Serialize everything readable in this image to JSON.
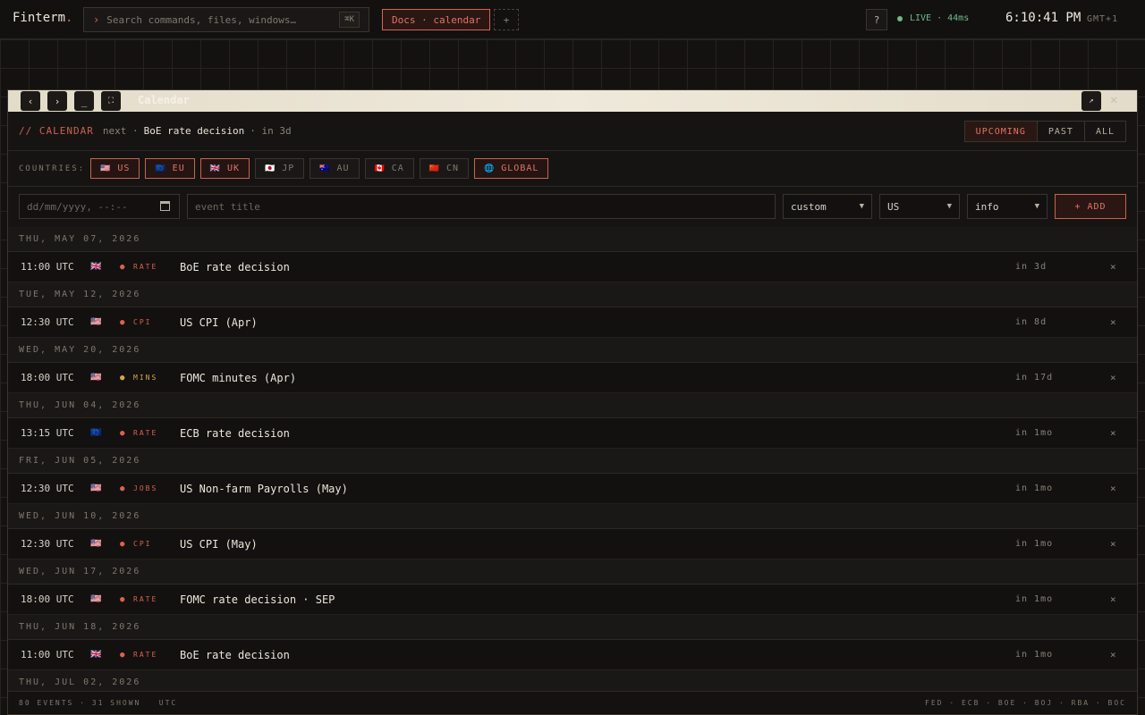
{
  "app": {
    "brand": "Finterm",
    "brand_dot": "."
  },
  "search": {
    "placeholder": "Search commands, files, windows…",
    "shortcut": "⌘K"
  },
  "tabs": {
    "active_label": "Docs · calendar",
    "add_label": "+"
  },
  "status": {
    "help": "?",
    "live": "LIVE · 44ms",
    "clock": "6:10:41 PM",
    "tz": "GMT+1"
  },
  "window": {
    "title": "Calendar",
    "back": "‹",
    "forward": "›",
    "minimize": "_",
    "maximize": "⛶",
    "popout": "↗",
    "close": "✕"
  },
  "subheader": {
    "label": "// CALENDAR",
    "next_prefix": "next ·",
    "next_event": "BoE rate decision",
    "next_rel": "· in 3d"
  },
  "filter": {
    "options": [
      "UPCOMING",
      "PAST",
      "ALL"
    ],
    "active": "UPCOMING"
  },
  "countries": {
    "label": "COUNTRIES:",
    "items": [
      {
        "flag": "🇺🇸",
        "code": "US",
        "active": true
      },
      {
        "flag": "🇪🇺",
        "code": "EU",
        "active": true
      },
      {
        "flag": "🇬🇧",
        "code": "UK",
        "active": true
      },
      {
        "flag": "🇯🇵",
        "code": "JP",
        "active": false
      },
      {
        "flag": "🇦🇺",
        "code": "AU",
        "active": false
      },
      {
        "flag": "🇨🇦",
        "code": "CA",
        "active": false
      },
      {
        "flag": "🇨🇳",
        "code": "CN",
        "active": false
      },
      {
        "flag": "🌐",
        "code": "GLOBAL",
        "active": true
      }
    ]
  },
  "form": {
    "datetime_placeholder": "dd/mm/yyyy, --:--",
    "title_placeholder": "event title",
    "type_value": "custom",
    "country_value": "US",
    "importance_value": "info",
    "add_label": "+ ADD"
  },
  "groups": [
    {
      "date": "THU, MAY 07, 2026",
      "events": [
        {
          "time": "11:00 UTC",
          "flag": "🇬🇧",
          "cat": "RATE",
          "color": "#d9624e",
          "title": "BoE rate decision",
          "rel": "in 3d"
        }
      ]
    },
    {
      "date": "TUE, MAY 12, 2026",
      "events": [
        {
          "time": "12:30 UTC",
          "flag": "🇺🇸",
          "cat": "CPI",
          "color": "#d9624e",
          "title": "US CPI (Apr)",
          "rel": "in 8d"
        }
      ]
    },
    {
      "date": "WED, MAY 20, 2026",
      "events": [
        {
          "time": "18:00 UTC",
          "flag": "🇺🇸",
          "cat": "MINS",
          "color": "#d9a24e",
          "title": "FOMC minutes (Apr)",
          "rel": "in 17d"
        }
      ]
    },
    {
      "date": "THU, JUN 04, 2026",
      "events": [
        {
          "time": "13:15 UTC",
          "flag": "🇪🇺",
          "cat": "RATE",
          "color": "#d9624e",
          "title": "ECB rate decision",
          "rel": "in 1mo"
        }
      ]
    },
    {
      "date": "FRI, JUN 05, 2026",
      "events": [
        {
          "time": "12:30 UTC",
          "flag": "🇺🇸",
          "cat": "JOBS",
          "color": "#d9624e",
          "title": "US Non-farm Payrolls (May)",
          "rel": "in 1mo"
        }
      ]
    },
    {
      "date": "WED, JUN 10, 2026",
      "events": [
        {
          "time": "12:30 UTC",
          "flag": "🇺🇸",
          "cat": "CPI",
          "color": "#d9624e",
          "title": "US CPI (May)",
          "rel": "in 1mo"
        }
      ]
    },
    {
      "date": "WED, JUN 17, 2026",
      "events": [
        {
          "time": "18:00 UTC",
          "flag": "🇺🇸",
          "cat": "RATE",
          "color": "#d9624e",
          "title": "FOMC rate decision · SEP",
          "rel": "in 1mo"
        }
      ]
    },
    {
      "date": "THU, JUN 18, 2026",
      "events": [
        {
          "time": "11:00 UTC",
          "flag": "🇬🇧",
          "cat": "RATE",
          "color": "#d9624e",
          "title": "BoE rate decision",
          "rel": "in 1mo"
        }
      ]
    },
    {
      "date": "THU, JUL 02, 2026",
      "events": []
    }
  ],
  "footer": {
    "left": "80 EVENTS · 31 SHOWN   UTC",
    "right": "FED · ECB · BOE · BOJ · RBA · BOC"
  },
  "delete_glyph": "×",
  "bullet_glyph": "●"
}
